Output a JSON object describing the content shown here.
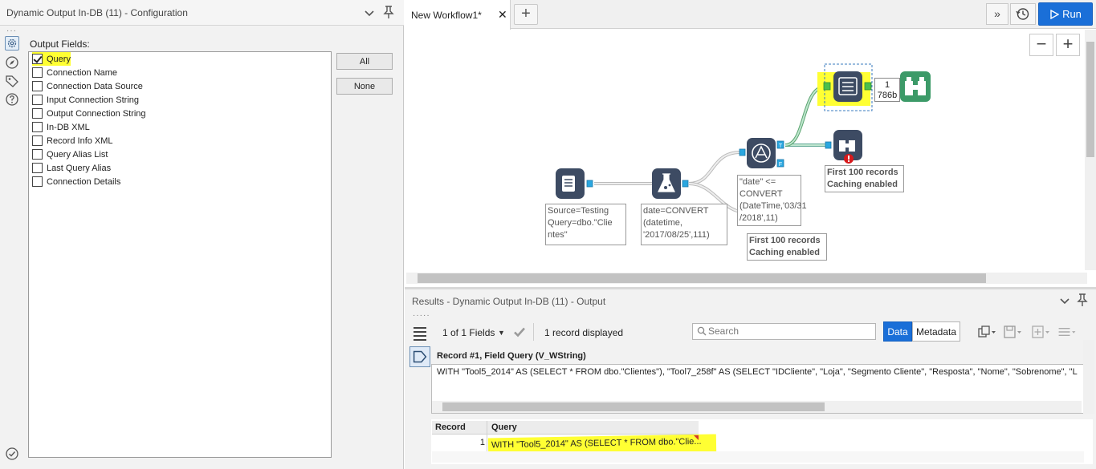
{
  "config": {
    "title": "Dynamic Output In-DB (11) - Configuration",
    "output_fields_label": "Output Fields:",
    "fields": [
      {
        "label": "Query",
        "checked": true
      },
      {
        "label": "Connection Name",
        "checked": false
      },
      {
        "label": "Connection Data Source",
        "checked": false
      },
      {
        "label": "Input Connection String",
        "checked": false
      },
      {
        "label": "Output Connection String",
        "checked": false
      },
      {
        "label": "In-DB XML",
        "checked": false
      },
      {
        "label": "Record Info XML",
        "checked": false
      },
      {
        "label": "Query Alias List",
        "checked": false
      },
      {
        "label": "Last Query Alias",
        "checked": false
      },
      {
        "label": "Connection Details",
        "checked": false
      }
    ],
    "btn_all": "All",
    "btn_none": "None"
  },
  "workflow": {
    "tab_label": "New Workflow1*",
    "tab_close": "✕",
    "run_label": "Run",
    "annotations": {
      "source": "Source=Testing\nQuery=dbo.\"Clie\nntes\"",
      "formula": "date=CONVERT\n(datetime,\n'2017/08/25',111)",
      "filter": "\"date\" <=\nCONVERT\n(DateTime,'03/31\n/2018',11)",
      "browse_top": "First 100 records\nCaching enabled",
      "browse_bottom": "First 100 records\nCaching enabled"
    },
    "record_count": "1",
    "record_size": "786b",
    "filter_true_label": "T",
    "filter_false_label": "F"
  },
  "results": {
    "title": "Results - Dynamic Output In-DB (11) - Output",
    "fields_dropdown": "1 of 1 Fields",
    "records_displayed": "1 record displayed",
    "search_placeholder": "Search",
    "btn_data": "Data",
    "btn_metadata": "Metadata",
    "record_header": "Record #1, Field Query (V_WString)",
    "record_value": "WITH \"Tool5_2014\" AS (SELECT * FROM dbo.\"Clientes\"), \"Tool7_258f\" AS (SELECT \"IDCliente\", \"Loja\", \"Segmento Cliente\", \"Resposta\", \"Nome\", \"Sobrenome\", \"L",
    "grid": {
      "columns": [
        "Record",
        "Query"
      ],
      "rows": [
        {
          "record": "1",
          "query": "WITH \"Tool5_2014\" AS (SELECT * FROM dbo.\"Clie..."
        }
      ]
    }
  },
  "colors": {
    "accent": "#1a6fd8",
    "highlight": "#ffff33",
    "node_dark": "#3d4b63",
    "node_green": "#3c9a68",
    "connector": "#2aa7e0"
  }
}
